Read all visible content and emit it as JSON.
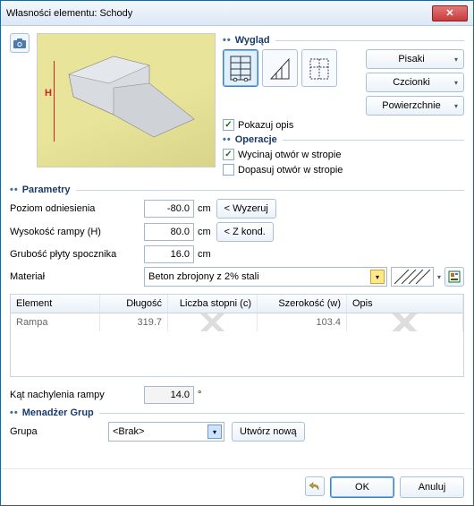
{
  "window": {
    "title": "Własności elementu: Schody"
  },
  "look": {
    "section": "Wygląd",
    "show_desc": "Pokazuj opis",
    "btn_pens": "Pisaki",
    "btn_fonts": "Czcionki",
    "btn_surfaces": "Powierzchnie"
  },
  "ops": {
    "section": "Operacje",
    "cut": "Wycinaj otwór w stropie",
    "fit": "Dopasuj otwór w stropie"
  },
  "params": {
    "section": "Parametry",
    "ref_level_label": "Poziom odniesienia",
    "ref_level_value": "-80.0",
    "ref_level_unit": "cm",
    "zero_btn": "< Wyzeruj",
    "ramp_h_label": "Wysokość rampy (H)",
    "ramp_h_value": "80.0",
    "ramp_h_unit": "cm",
    "kond_btn": "< Z kond.",
    "slab_thk_label": "Grubość płyty spocznika",
    "slab_thk_value": "16.0",
    "slab_thk_unit": "cm",
    "material_label": "Materiał",
    "material_value": "Beton zbrojony z 2% stali",
    "angle_label": "Kąt nachylenia rampy",
    "angle_value": "14.0",
    "angle_unit": "°"
  },
  "table": {
    "headers": [
      "Element",
      "Długość",
      "Liczba stopni (c)",
      "Szerokość (w)",
      "Opis"
    ],
    "rows": [
      {
        "element": "Rampa",
        "length": "319.7",
        "steps": "",
        "width": "103.4",
        "desc": ""
      }
    ]
  },
  "groups": {
    "section": "Menadżer Grup",
    "label": "Grupa",
    "value": "<Brak>",
    "create": "Utwórz nową"
  },
  "footer": {
    "ok": "OK",
    "cancel": "Anuluj"
  },
  "preview": {
    "h_label": "H"
  }
}
